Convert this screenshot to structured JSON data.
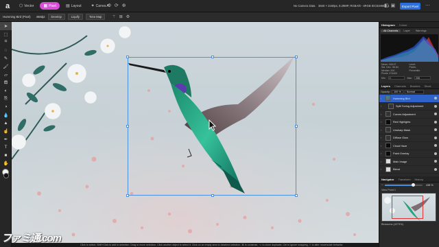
{
  "app": {
    "logo_glyph": "a",
    "personas": [
      {
        "label": "Vector",
        "icon": "⬡",
        "active": false
      },
      {
        "label": "Pixel",
        "icon": "▦",
        "active": true
      },
      {
        "label": "Layout",
        "icon": "▤",
        "active": false
      },
      {
        "label": "Canva AI",
        "icon": "✦",
        "active": false
      }
    ],
    "doc_status": "No Camera Data",
    "doc_info": "3840 × 2160px, 8.29MP, RGBA/8 - sRGB IEC61966-2.1",
    "export_label": "Export Pixel"
  },
  "context": {
    "document_name": "Humming Bird (Pixel)",
    "size": "468dpi",
    "buttons": [
      "Develop",
      "Liquify",
      "Tone Map"
    ]
  },
  "tools": [
    "move",
    "select",
    "crop",
    "lasso",
    "paint",
    "brush",
    "erase",
    "fill",
    "gradient",
    "clone",
    "dodge",
    "blur",
    "sharpen",
    "smudge",
    "pen",
    "text",
    "shape",
    "hand",
    "zoom"
  ],
  "status_bar": "Click to select, Shift+Click to add to selection. Drag to move selection. Click another object to select it. Click on an empty area to deselect selection. ⌘ to constrain, ⌥ to clone duplicate, Ctrl to ignore snapping, ⇧ to alter move/scale behavior.",
  "watermark": "ファミ通.com",
  "histogram": {
    "tabs": [
      "Histogram",
      "Colour"
    ],
    "subtabs": [
      "All Channels",
      "Layer",
      "Warnings"
    ],
    "stats_left": [
      "Mean: 165.97",
      "Std. Dev.: 56.84",
      "Median: 200",
      "Pixels: 374400"
    ],
    "stats_right": [
      "Level:",
      "Pixels:",
      "Percentile:"
    ],
    "min_label": "Min",
    "min_value": "0",
    "max_label": "Max",
    "max_value": "255"
  },
  "layers": {
    "tabs": [
      "Layers",
      "Channels",
      "Brushes",
      "Stock"
    ],
    "opacity_label": "Opacity:",
    "opacity_value": "100 %",
    "blend_mode": "Normal",
    "items": [
      {
        "name": "Humming Bird",
        "thumb": "bird",
        "selected": true,
        "child": false
      },
      {
        "name": "Split Toning Adjustment",
        "thumb": "adj",
        "selected": false,
        "child": true
      },
      {
        "name": "Curves Adjustment",
        "thumb": "adj",
        "selected": false,
        "child": false
      },
      {
        "name": "Red Highlights",
        "thumb": "dark",
        "selected": false,
        "child": false
      },
      {
        "name": "Unsharp Mask",
        "thumb": "adj",
        "selected": false,
        "child": false
      },
      {
        "name": "Diffuse Glow",
        "thumb": "adj",
        "selected": false,
        "child": false
      },
      {
        "name": "Cloud Haze",
        "thumb": "dark",
        "selected": false,
        "child": false
      },
      {
        "name": "Paint Overlay",
        "thumb": "dark",
        "selected": false,
        "child": false
      },
      {
        "name": "Main Image",
        "thumb": "plain",
        "selected": false,
        "child": false
      },
      {
        "name": "Blend",
        "thumb": "plain",
        "selected": false,
        "child": false
      }
    ]
  },
  "navigator": {
    "tabs": [
      "Navigator",
      "Transform",
      "History"
    ],
    "zoom_value": "438 %",
    "zoom_fraction": 0.75,
    "view_point_label": "View Point 1",
    "caption": "Blossoms (4273%)"
  },
  "colors": {
    "accent": "#2a6fdb",
    "pixel_persona": "#d64fd6",
    "selection": "#4a90e2"
  }
}
